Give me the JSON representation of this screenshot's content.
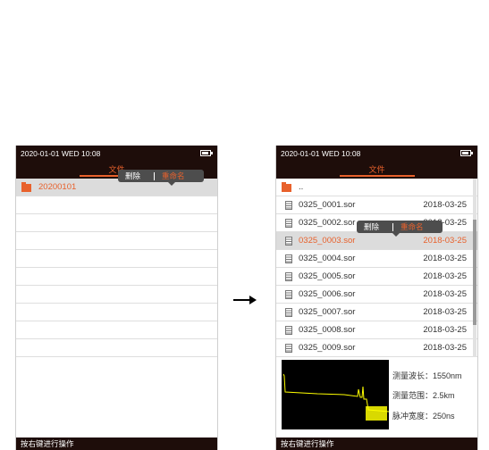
{
  "left_screen": {
    "status": "2020-01-01  WED  10:08",
    "tab": "文件",
    "folder_name": "20200101",
    "popup": {
      "delete": "删除",
      "rename": "重命名"
    },
    "hint": "按右键进行操作"
  },
  "arrow": "→",
  "right_screen": {
    "status": "2020-01-01  WED  10:08",
    "tab": "文件",
    "parent_dir": "..",
    "files": [
      {
        "name": "0325_0001.sor",
        "date": "2018-03-25"
      },
      {
        "name": "0325_0002.sor",
        "date": "2018-03-25"
      },
      {
        "name": "0325_0003.sor",
        "date": "2018-03-25"
      },
      {
        "name": "0325_0004.sor",
        "date": "2018-03-25"
      },
      {
        "name": "0325_0005.sor",
        "date": "2018-03-25"
      },
      {
        "name": "0325_0006.sor",
        "date": "2018-03-25"
      },
      {
        "name": "0325_0007.sor",
        "date": "2018-03-25"
      },
      {
        "name": "0325_0008.sor",
        "date": "2018-03-25"
      },
      {
        "name": "0325_0009.sor",
        "date": "2018-03-25"
      }
    ],
    "popup": {
      "delete": "删除",
      "rename": "重命名"
    },
    "info": {
      "wavelength": "测量波长：1550nm",
      "range": "测量范围：2.5km",
      "pulse": "脉冲宽度：250ns"
    },
    "hint": "按右键进行操作"
  },
  "colors": {
    "accent": "#e8612c",
    "bar": "#1e0d0a",
    "selected_row": "#dcdcdc",
    "trace": "#ffff00"
  }
}
